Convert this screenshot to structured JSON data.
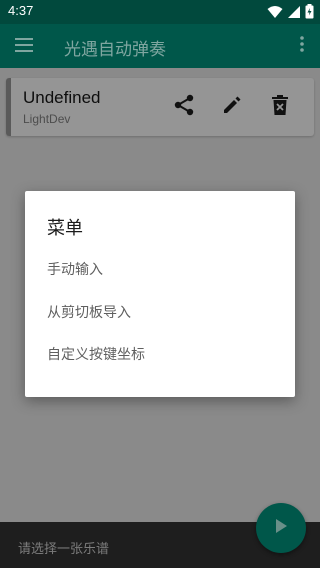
{
  "status_bar": {
    "time": "4:37",
    "icons": [
      "wifi-icon",
      "signal-icon",
      "battery-icon"
    ]
  },
  "app_bar": {
    "title": "光遇自动弹奏",
    "left_icon": "menu-icon",
    "right_icon": "more-vert-icon"
  },
  "song_card": {
    "title": "Undefined",
    "author": "LightDev",
    "actions": [
      "share-icon",
      "edit-icon",
      "delete-icon"
    ]
  },
  "dialog": {
    "title": "菜单",
    "items": [
      {
        "label": "手动输入"
      },
      {
        "label": "从剪切板导入"
      },
      {
        "label": "自定义按键坐标"
      }
    ]
  },
  "bottom_bar": {
    "placeholder": "请选择一张乐谱",
    "fab_icon": "play-icon"
  },
  "colors": {
    "primary": "#00574a",
    "status_bar": "#01493d",
    "bottom_bar": "#1e1e1e"
  }
}
